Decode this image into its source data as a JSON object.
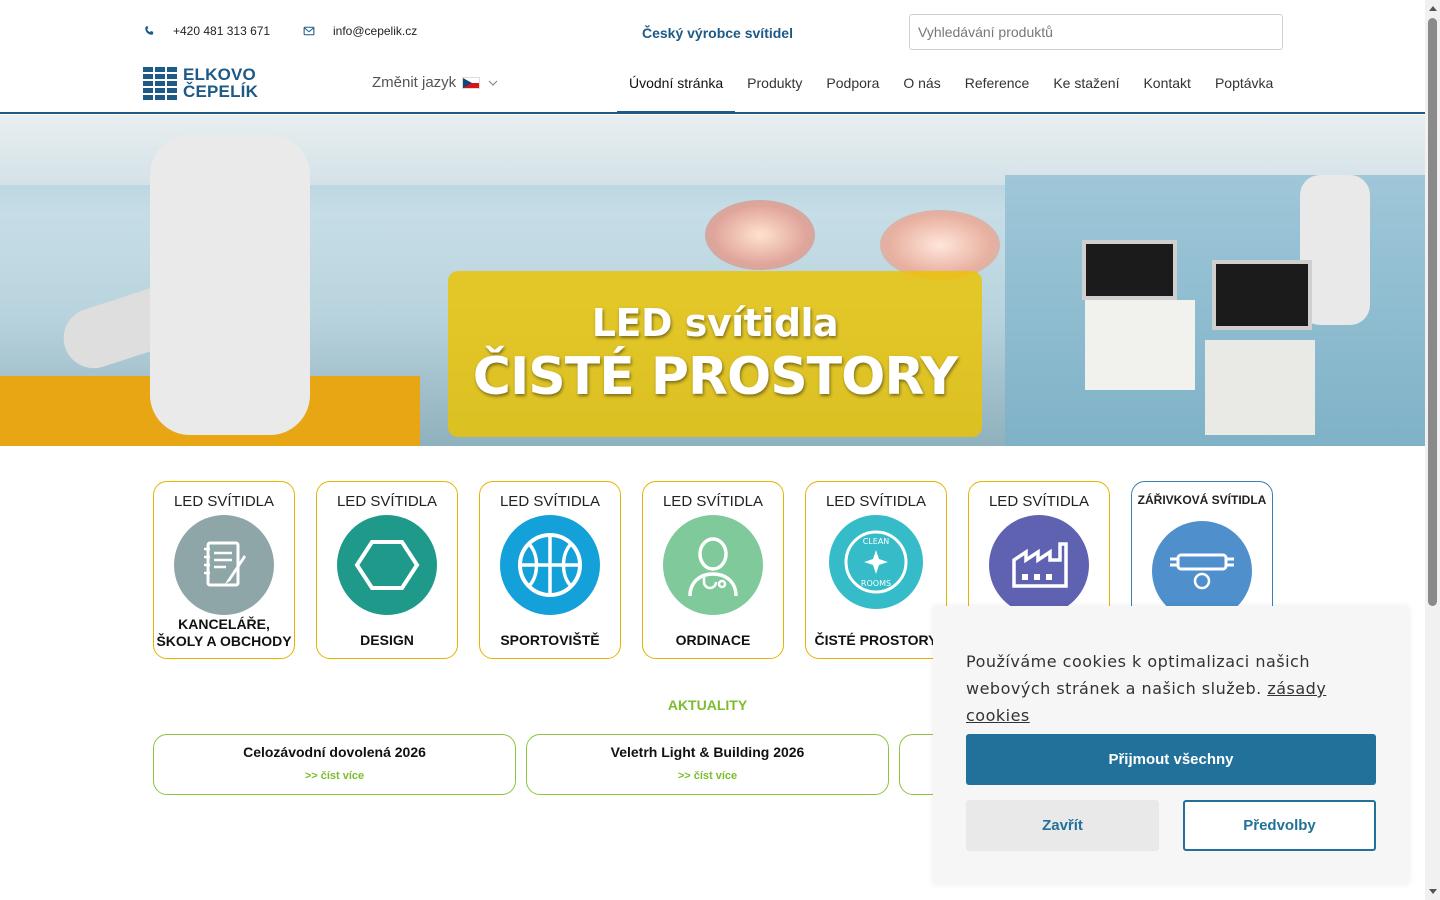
{
  "header": {
    "phone": "+420 481 313 671",
    "email": "info@cepelik.cz",
    "tagline": "Český výrobce svítidel",
    "search_placeholder": "Vyhledávání produktů",
    "logo_line1": "ELKOVO",
    "logo_line2": "ČEPELÍK",
    "lang_label": "Změnit jazyk",
    "nav": [
      {
        "label": "Úvodní stránka",
        "active": true
      },
      {
        "label": "Produkty"
      },
      {
        "label": "Podpora"
      },
      {
        "label": "O nás"
      },
      {
        "label": "Reference"
      },
      {
        "label": "Ke stažení"
      },
      {
        "label": "Kontakt"
      },
      {
        "label": "Poptávka"
      }
    ]
  },
  "hero": {
    "line1": "LED svítidla",
    "line2": "ČISTÉ PROSTORY"
  },
  "categories": [
    {
      "top": "LED SVÍTIDLA",
      "bottom": "KANCELÁŘE, ŠKOLY A OBCHODY",
      "icon": "notebook-icon",
      "color": "#8fa6a9"
    },
    {
      "top": "LED SVÍTIDLA",
      "bottom": "DESIGN",
      "icon": "hexagon-icon",
      "color": "#1f9a8a"
    },
    {
      "top": "LED SVÍTIDLA",
      "bottom": "SPORTOVIŠTĚ",
      "icon": "basketball-icon",
      "color": "#14a0d8"
    },
    {
      "top": "LED SVÍTIDLA",
      "bottom": "ORDINACE",
      "icon": "doctor-icon",
      "color": "#7fc99a"
    },
    {
      "top": "LED SVÍTIDLA",
      "bottom": "ČISTÉ PROSTORY",
      "icon": "clean-rooms-icon",
      "color": "#35bcc8",
      "icon_text_top": "CLEAN",
      "icon_text_bottom": "ROOMS"
    },
    {
      "top": "LED SVÍTIDLA",
      "bottom": "",
      "icon": "factory-icon",
      "color": "#5f62b0"
    },
    {
      "top": "ZÁŘIVKOVÁ SVÍTIDLA",
      "bottom": "",
      "icon": "fluorescent-tube-icon",
      "color": "#4f8fcc"
    }
  ],
  "news": {
    "title": "AKTUALITY",
    "items": [
      {
        "title": "Celozávodní dovolená 2026",
        "more": ">> číst více"
      },
      {
        "title": "Veletrh Light & Building 2026",
        "more": ">> číst více"
      }
    ]
  },
  "cookie": {
    "message": "Používáme cookies k optimalizaci našich webových stránek a našich služeb.",
    "policy_link": "zásady cookies",
    "accept_all": "Přijmout všechny",
    "close": "Zavřít",
    "preferences": "Předvolby"
  },
  "colors": {
    "brand_blue": "#1d5a86",
    "hero_yellow": "#ecc300",
    "news_green": "#7bbd2d",
    "cookie_button": "#21719a"
  }
}
